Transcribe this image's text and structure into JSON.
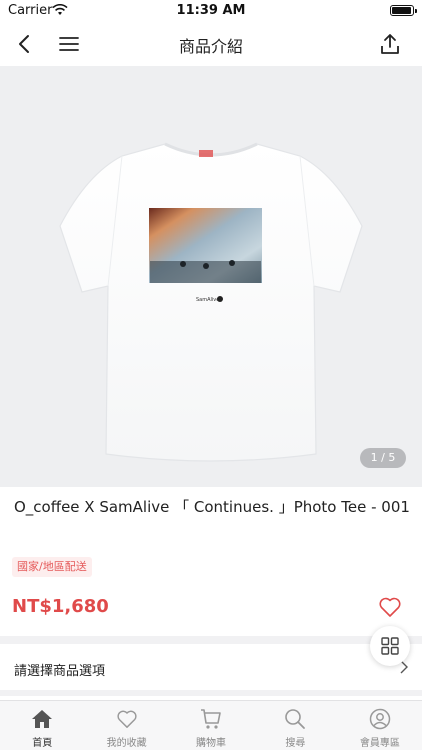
{
  "status_bar": {
    "carrier": "Carrier",
    "time": "11:39 AM"
  },
  "nav": {
    "title": "商品介紹"
  },
  "gallery": {
    "counter": "1 / 5"
  },
  "product": {
    "title": "O_coffee X SamAlive 「 Continues. 」Photo Tee - 001",
    "shipping_tag": "國家/地區配送",
    "price": "NT$1,680"
  },
  "options": {
    "label": "請選擇商品選項"
  },
  "tabs": [
    {
      "label": "首頁",
      "icon": "home-icon"
    },
    {
      "label": "我的收藏",
      "icon": "heart-icon"
    },
    {
      "label": "購物車",
      "icon": "cart-icon"
    },
    {
      "label": "搜尋",
      "icon": "search-icon"
    },
    {
      "label": "會員專區",
      "icon": "user-icon"
    }
  ],
  "colors": {
    "price": "#e04a4a",
    "tag_bg": "#fdeeee",
    "image_bg": "#eeeff1",
    "tab_bg": "#f7f7f8"
  }
}
